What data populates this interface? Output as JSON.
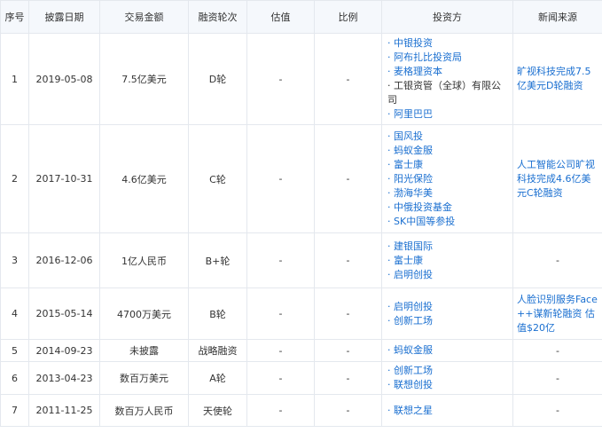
{
  "headers": [
    "序号",
    "披露日期",
    "交易金额",
    "融资轮次",
    "估值",
    "比例",
    "投资方",
    "新闻来源"
  ],
  "rows": [
    {
      "no": "1",
      "date": "2019-05-08",
      "amount": "7.5亿美元",
      "round": "D轮",
      "valuation": "-",
      "ratio": "-",
      "investors": [
        {
          "t": "· 中银投资",
          "link": true
        },
        {
          "t": "· 阿布扎比投资局",
          "link": true
        },
        {
          "t": "· 麦格理资本",
          "link": true
        },
        {
          "t": "· 工银资管（全球）有限公司",
          "link": false
        },
        {
          "t": "· 阿里巴巴",
          "link": true
        }
      ],
      "news": "旷视科技完成7.5亿美元D轮融资"
    },
    {
      "no": "2",
      "date": "2017-10-31",
      "amount": "4.6亿美元",
      "round": "C轮",
      "valuation": "-",
      "ratio": "-",
      "investors": [
        {
          "t": "· 国风投",
          "link": true
        },
        {
          "t": "· 蚂蚁金服",
          "link": true
        },
        {
          "t": "· 富士康",
          "link": true
        },
        {
          "t": "· 阳光保险",
          "link": true
        },
        {
          "t": "· 渤海华美",
          "link": true
        },
        {
          "t": "· 中俄投资基金",
          "link": true
        },
        {
          "t": "· SK中国等参投",
          "link": true
        }
      ],
      "news": "人工智能公司旷视科技完成4.6亿美元C轮融资"
    },
    {
      "no": "3",
      "date": "2016-12-06",
      "amount": "1亿人民币",
      "round": "B+轮",
      "valuation": "-",
      "ratio": "-",
      "investors": [
        {
          "t": "· 建银国际",
          "link": true
        },
        {
          "t": "· 富士康",
          "link": true
        },
        {
          "t": "· 启明创投",
          "link": true
        }
      ],
      "news": "-"
    },
    {
      "no": "4",
      "date": "2015-05-14",
      "amount": "4700万美元",
      "round": "B轮",
      "valuation": "-",
      "ratio": "-",
      "investors": [
        {
          "t": "· 启明创投",
          "link": true
        },
        {
          "t": "· 创新工场",
          "link": true
        }
      ],
      "news": "人脸识别服务Face++谋新轮融资 估值$20亿"
    },
    {
      "no": "5",
      "date": "2014-09-23",
      "amount": "未披露",
      "round": "战略融资",
      "valuation": "-",
      "ratio": "-",
      "investors": [
        {
          "t": "· 蚂蚁金服",
          "link": true
        }
      ],
      "news": "-"
    },
    {
      "no": "6",
      "date": "2013-04-23",
      "amount": "数百万美元",
      "round": "A轮",
      "valuation": "-",
      "ratio": "-",
      "investors": [
        {
          "t": "· 创新工场",
          "link": true
        },
        {
          "t": "· 联想创投",
          "link": true
        }
      ],
      "news": "-"
    },
    {
      "no": "7",
      "date": "2011-11-25",
      "amount": "数百万人民币",
      "round": "天使轮",
      "valuation": "-",
      "ratio": "-",
      "investors": [
        {
          "t": "· 联想之星",
          "link": true
        }
      ],
      "news": "-"
    }
  ]
}
